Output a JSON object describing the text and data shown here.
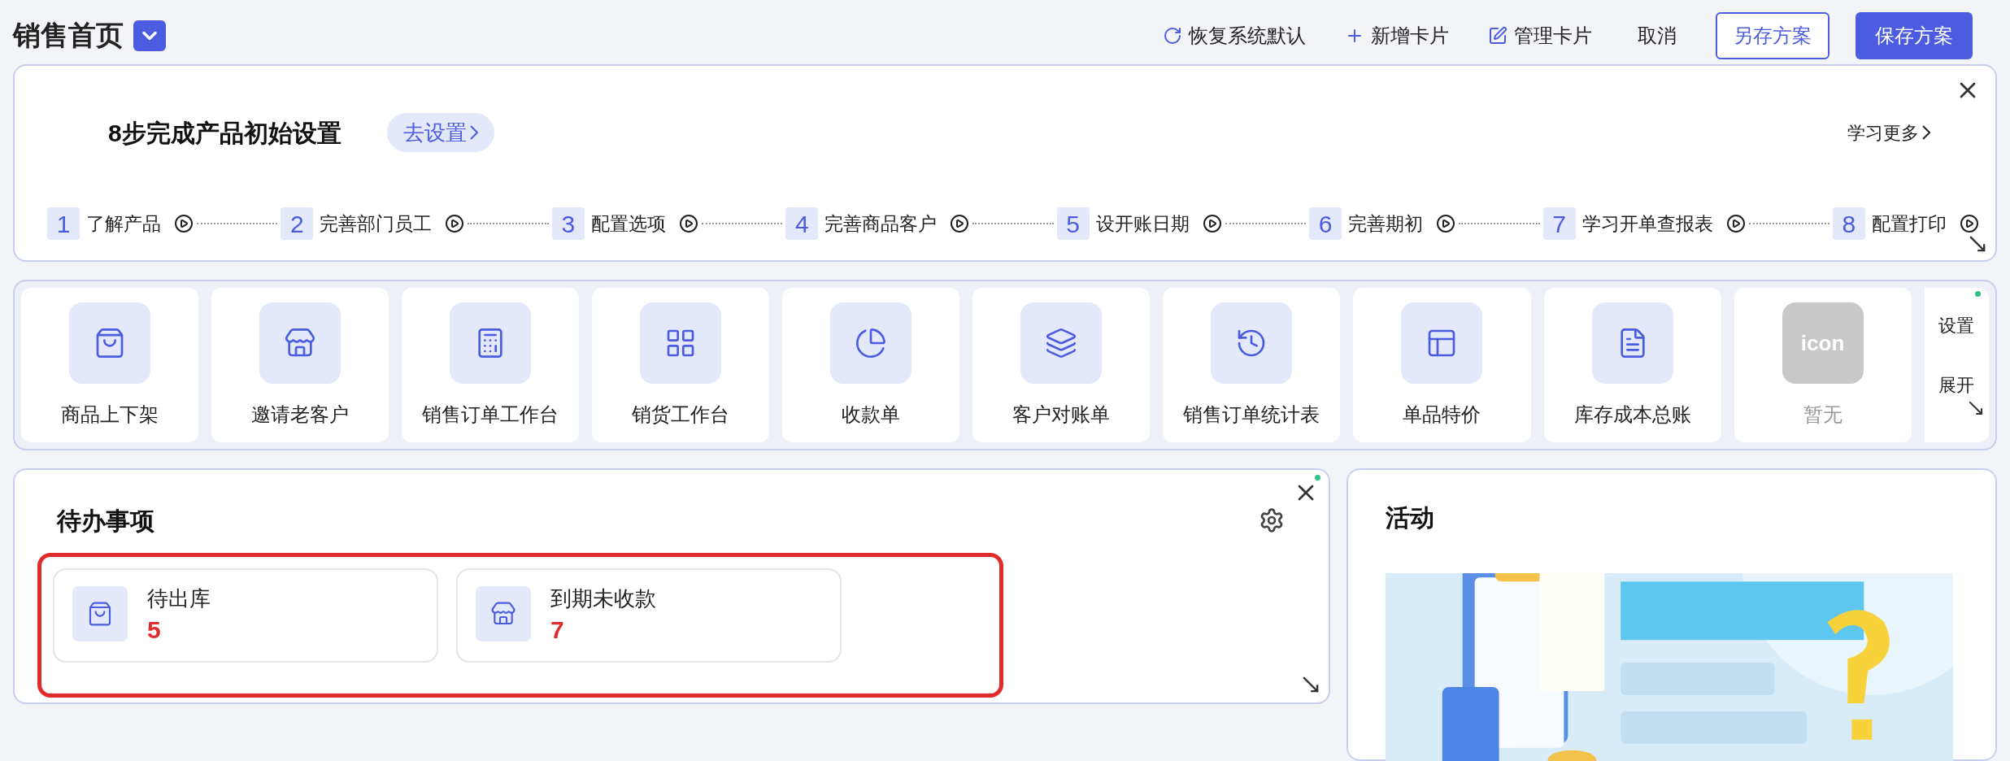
{
  "header": {
    "title": "销售首页",
    "actions": [
      {
        "kind": "link",
        "label": "恢复系统默认"
      },
      {
        "kind": "link",
        "label": "新增卡片"
      },
      {
        "kind": "link",
        "label": "管理卡片"
      },
      {
        "kind": "text",
        "label": "取消"
      },
      {
        "kind": "outline",
        "label": "另存方案"
      },
      {
        "kind": "primary",
        "label": "保存方案"
      }
    ]
  },
  "setup_card": {
    "title": "8步完成产品初始设置",
    "go_button": "去设置",
    "learn_more": "学习更多",
    "steps": [
      {
        "number": "1",
        "label": "了解产品"
      },
      {
        "number": "2",
        "label": "完善部门员工"
      },
      {
        "number": "3",
        "label": "配置选项"
      },
      {
        "number": "4",
        "label": "完善商品客户"
      },
      {
        "number": "5",
        "label": "设开账日期"
      },
      {
        "number": "6",
        "label": "完善期初"
      },
      {
        "number": "7",
        "label": "学习开单查报表"
      },
      {
        "number": "8",
        "label": "配置打印"
      }
    ]
  },
  "shortcuts": {
    "items": [
      {
        "kind": "icon",
        "label": "商品上下架"
      },
      {
        "kind": "icon",
        "label": "邀请老客户"
      },
      {
        "kind": "icon",
        "label": "销售订单工作台"
      },
      {
        "kind": "icon",
        "label": "销货工作台"
      },
      {
        "kind": "icon",
        "label": "收款单"
      },
      {
        "kind": "icon",
        "label": "客户对账单"
      },
      {
        "kind": "icon",
        "label": "销售订单统计表"
      },
      {
        "kind": "icon",
        "label": "单品特价"
      },
      {
        "kind": "icon",
        "label": "库存成本总账"
      },
      {
        "kind": "placeholder",
        "icon_text": "icon",
        "label": "暂无"
      }
    ],
    "settings": "设置",
    "expand": "展开"
  },
  "todo_card": {
    "title": "待办事项",
    "highlighted": true,
    "items": [
      {
        "label": "待出库",
        "count": "5"
      },
      {
        "label": "到期未收款",
        "count": "7"
      }
    ]
  },
  "activity_card": {
    "title": "活动"
  }
}
